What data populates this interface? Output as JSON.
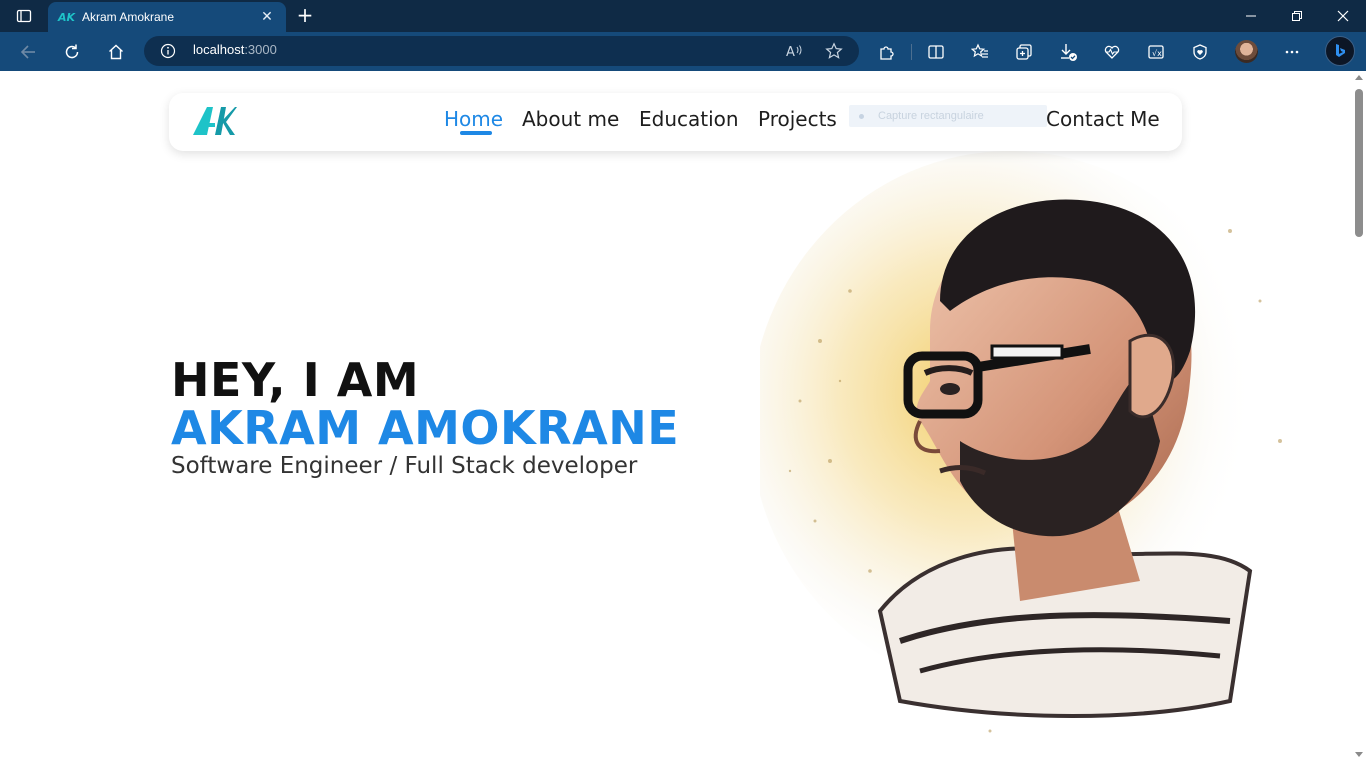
{
  "browser": {
    "tab_title": "Akram Amokrane",
    "tab_favicon": "AK",
    "url_host": "localhost",
    "url_port": ":3000",
    "icons": {
      "tab_actions": "tab-actions-icon",
      "close_tab": "close-icon",
      "new_tab": "plus-icon",
      "back": "back-arrow-icon",
      "refresh": "refresh-icon",
      "home": "home-icon",
      "site_info": "info-icon",
      "read_aloud": "read-aloud-icon",
      "favorite": "star-icon",
      "extensions": "puzzle-icon",
      "split_screen": "split-screen-icon",
      "favorites_bar": "favorites-icon",
      "collections": "collections-icon",
      "downloads": "download-icon",
      "performance": "heartbeat-icon",
      "math_solver": "math-icon",
      "browser_essentials": "shield-heart-icon",
      "profile": "avatar",
      "more": "more-icon",
      "copilot": "bing-icon"
    },
    "colors": {
      "titlebar": "#0f2a45",
      "toolbar": "#154a7a"
    }
  },
  "page": {
    "logo_text": "AK",
    "nav": {
      "items": [
        {
          "label": "Home",
          "active": true
        },
        {
          "label": "About me",
          "active": false
        },
        {
          "label": "Education",
          "active": false
        },
        {
          "label": "Projects",
          "active": false
        },
        {
          "label": "Contact Me",
          "active": false
        }
      ]
    },
    "capture_tooltip": "Capture rectangulaire",
    "hero": {
      "greeting": "HEY, I AM",
      "name": "AKRAM AMOKRANE",
      "role": "Software Engineer / Full Stack developer"
    },
    "colors": {
      "accent": "#1e88e5",
      "logo": "#1ec3c8",
      "text": "#111111"
    }
  }
}
